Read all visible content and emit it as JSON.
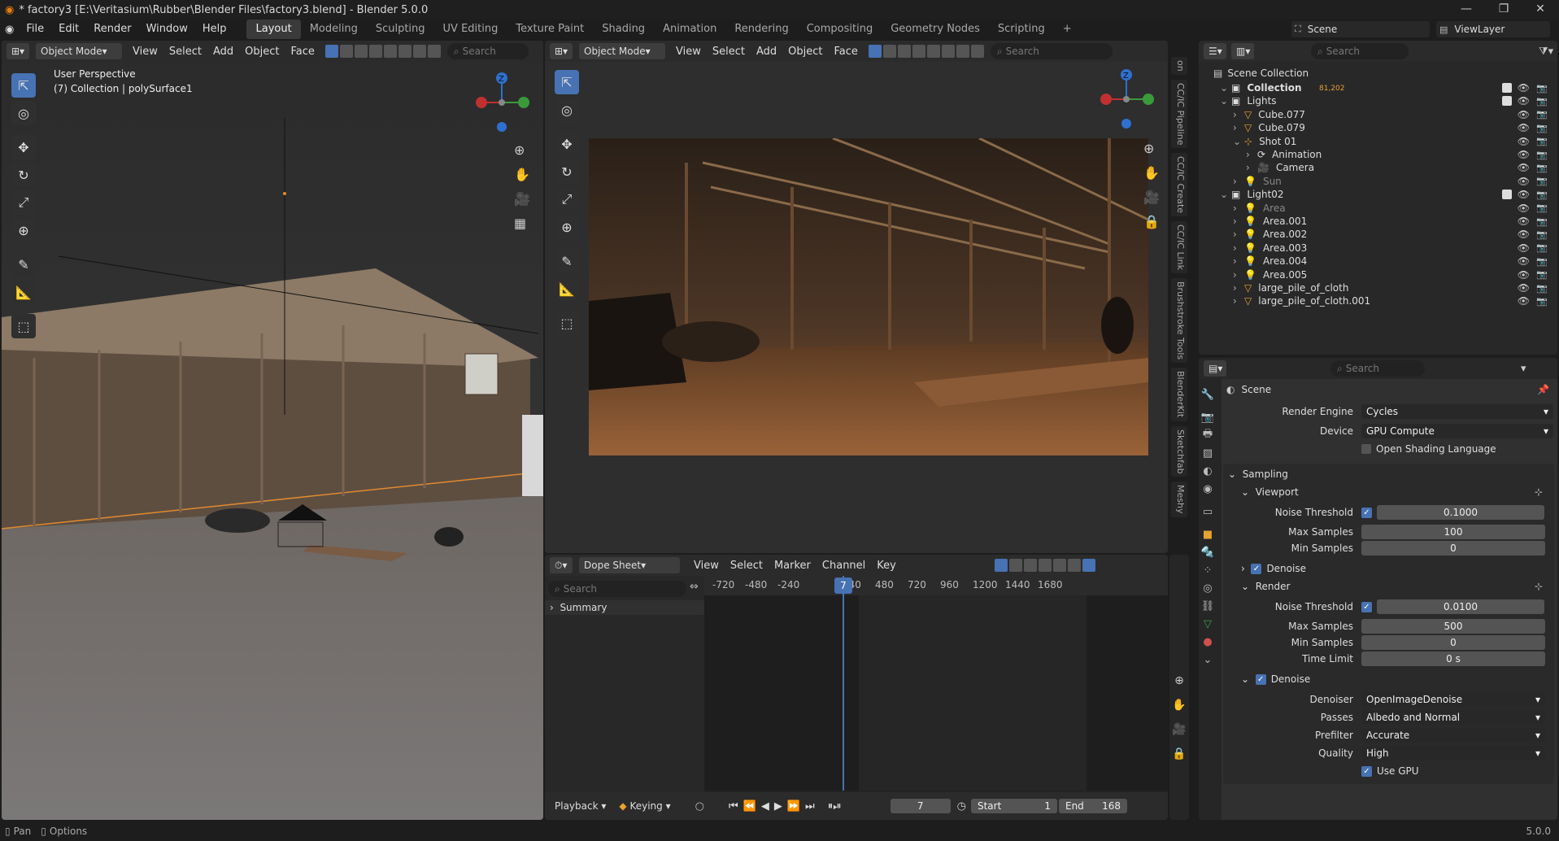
{
  "window": {
    "title": "* factory3 [E:\\Veritasium\\Rubber\\Blender Files\\factory3.blend] - Blender 5.0.0",
    "minimize": "—",
    "maximize": "❐",
    "close": "✕"
  },
  "menus": [
    "File",
    "Edit",
    "Render",
    "Window",
    "Help"
  ],
  "workspaces": [
    "Layout",
    "Modeling",
    "Sculpting",
    "UV Editing",
    "Texture Paint",
    "Shading",
    "Animation",
    "Rendering",
    "Compositing",
    "Geometry Nodes",
    "Scripting"
  ],
  "workspace_add": "+",
  "scene": {
    "name": "Scene",
    "view_layer": "ViewLayer"
  },
  "viewport_left": {
    "mode": "Object Mode",
    "menus": [
      "View",
      "Select",
      "Add",
      "Object",
      "Face"
    ],
    "search_placeholder": "Search",
    "overlay_title": "User Perspective",
    "overlay_sub": "(7) Collection | polySurface1",
    "gizmo_z": "Z"
  },
  "viewport_right": {
    "mode": "Object Mode",
    "menus": [
      "View",
      "Select",
      "Add",
      "Object",
      "Face"
    ],
    "search_placeholder": "Search",
    "gizmo_z": "Z",
    "side_tabs": [
      "on",
      "CC/IC Pipeline",
      "CC/IC Create",
      "CC/IC Link",
      "Brushstroke Tools",
      "BlenderKit",
      "Sketchfab",
      "Meshy"
    ]
  },
  "dopesheet": {
    "mode": "Dope Sheet",
    "menus": [
      "View",
      "Select",
      "Marker",
      "Channel",
      "Key"
    ],
    "search_placeholder": "Search",
    "summary": "Summary",
    "ticks": [
      "-720",
      "-480",
      "-240",
      "7",
      "240",
      "480",
      "720",
      "960",
      "1200",
      "1440",
      "1680"
    ],
    "current_frame": "7",
    "playback": "Playback",
    "keying": "Keying",
    "frame_field": "7",
    "start_label": "Start",
    "start": "1",
    "end_label": "End",
    "end": "168"
  },
  "outliner": {
    "search_placeholder": "Search",
    "root": "Scene Collection",
    "collection_badge": "81,202",
    "rows": [
      {
        "label": "Collection",
        "indent": 1,
        "type": "collection",
        "bold": true
      },
      {
        "label": "Lights",
        "indent": 1,
        "type": "collection"
      },
      {
        "label": "Cube.077",
        "indent": 2,
        "type": "mesh"
      },
      {
        "label": "Cube.079",
        "indent": 2,
        "type": "mesh"
      },
      {
        "label": "Shot 01",
        "indent": 2,
        "type": "empty"
      },
      {
        "label": "Animation",
        "indent": 3,
        "type": "anim"
      },
      {
        "label": "Camera",
        "indent": 3,
        "type": "camera"
      },
      {
        "label": "Sun",
        "indent": 2,
        "type": "light",
        "dim": true
      },
      {
        "label": "Light02",
        "indent": 1,
        "type": "collection"
      },
      {
        "label": "Area",
        "indent": 2,
        "type": "light",
        "dim": true
      },
      {
        "label": "Area.001",
        "indent": 2,
        "type": "light"
      },
      {
        "label": "Area.002",
        "indent": 2,
        "type": "light"
      },
      {
        "label": "Area.003",
        "indent": 2,
        "type": "light"
      },
      {
        "label": "Area.004",
        "indent": 2,
        "type": "light"
      },
      {
        "label": "Area.005",
        "indent": 2,
        "type": "light"
      },
      {
        "label": "large_pile_of_cloth",
        "indent": 2,
        "type": "mesh"
      },
      {
        "label": "large_pile_of_cloth.001",
        "indent": 2,
        "type": "mesh"
      }
    ]
  },
  "properties": {
    "search_placeholder": "Search",
    "context": "Scene",
    "render_engine_label": "Render Engine",
    "render_engine": "Cycles",
    "device_label": "Device",
    "device": "GPU Compute",
    "osl_label": "Open Shading Language",
    "sampling": "Sampling",
    "viewport": "Viewport",
    "vp_noise_label": "Noise Threshold",
    "vp_noise": "0.1000",
    "vp_max_label": "Max Samples",
    "vp_max": "100",
    "vp_min_label": "Min Samples",
    "vp_min": "0",
    "vp_denoise": "Denoise",
    "render": "Render",
    "r_noise_label": "Noise Threshold",
    "r_noise": "0.0100",
    "r_max_label": "Max Samples",
    "r_max": "500",
    "r_min_label": "Min Samples",
    "r_min": "0",
    "r_time_label": "Time Limit",
    "r_time": "0 s",
    "r_denoise": "Denoise",
    "denoiser_label": "Denoiser",
    "denoiser": "OpenImageDenoise",
    "passes_label": "Passes",
    "passes": "Albedo and Normal",
    "prefilter_label": "Prefilter",
    "prefilter": "Accurate",
    "quality_label": "Quality",
    "quality": "High",
    "use_gpu": "Use GPU"
  },
  "statusbar": {
    "pan": "Pan",
    "options": "Options",
    "version": "5.0.0"
  },
  "colors": {
    "accent": "#4772b3",
    "header": "#2b2b2b",
    "panel": "#303030"
  }
}
